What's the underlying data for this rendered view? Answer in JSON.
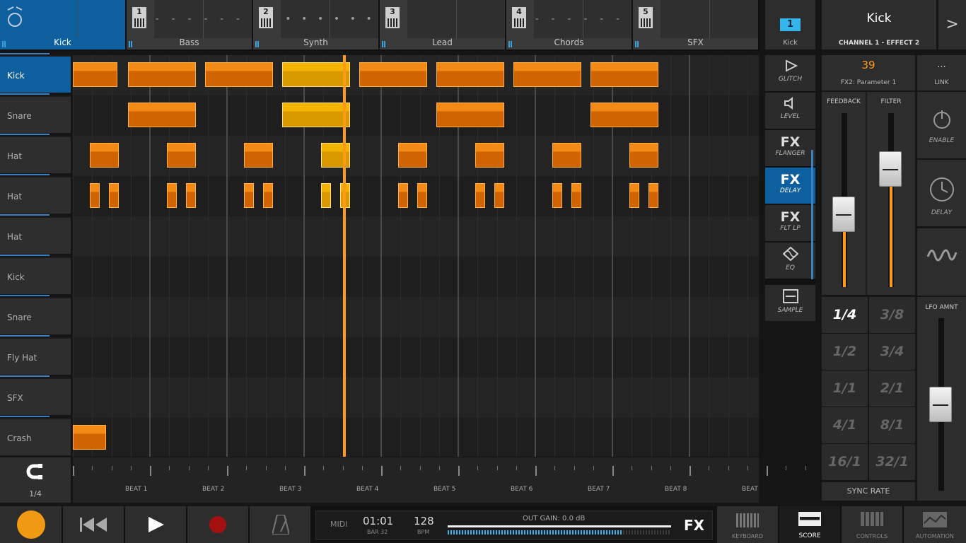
{
  "tracks": [
    {
      "label": "Kick",
      "pattern": ""
    },
    {
      "label": "Bass",
      "num": "1",
      "pattern": "- - - -  - - - -"
    },
    {
      "label": "Synth",
      "num": "2",
      "pattern": "• • •   • • •"
    },
    {
      "label": "Lead",
      "num": "3",
      "pattern": "_ _ _ _ _ _ _ _"
    },
    {
      "label": "Chords",
      "num": "4",
      "pattern": "- - - - - - - - -"
    },
    {
      "label": "SFX",
      "num": "5",
      "pattern": "___________"
    }
  ],
  "channel": {
    "number": "1",
    "label": "Kick"
  },
  "header": {
    "title": "Kick",
    "subtitle": "CHANNEL 1 - EFFECT 2",
    "next": ">"
  },
  "rows": [
    "Kick",
    "Snare",
    "Hat",
    "Hat",
    "Hat",
    "Kick",
    "Snare",
    "Fly Hat",
    "SFX",
    "Crash"
  ],
  "notes": [
    {
      "row": 0,
      "cols": [
        [
          0,
          0.6
        ],
        [
          0.7,
          1.6
        ],
        [
          1.7,
          2.6
        ],
        [
          2.7,
          3.6
        ],
        [
          3.7,
          4.6
        ],
        [
          4.7,
          5.6
        ],
        [
          5.7,
          6.6
        ],
        [
          6.7,
          7.6
        ]
      ],
      "sel": [
        3
      ]
    },
    {
      "row": 1,
      "cols": [
        [
          0.7,
          1.6
        ],
        [
          2.7,
          3.6
        ],
        [
          4.7,
          5.6
        ],
        [
          6.7,
          7.6
        ]
      ],
      "sel": [
        1
      ]
    },
    {
      "row": 2,
      "cols": [
        [
          0.2,
          0.6
        ],
        [
          1.2,
          1.6
        ],
        [
          2.2,
          2.6
        ],
        [
          3.2,
          3.6
        ],
        [
          4.2,
          4.6
        ],
        [
          5.2,
          5.6
        ],
        [
          6.2,
          6.6
        ],
        [
          7.2,
          7.6
        ]
      ],
      "sel": [
        3
      ]
    },
    {
      "row": 3,
      "cols": [
        [
          0.2,
          0.35
        ],
        [
          0.45,
          0.6
        ],
        [
          1.2,
          1.35
        ],
        [
          1.45,
          1.6
        ],
        [
          2.2,
          2.35
        ],
        [
          2.45,
          2.6
        ],
        [
          3.2,
          3.35
        ],
        [
          3.45,
          3.6
        ],
        [
          4.2,
          4.35
        ],
        [
          4.45,
          4.6
        ],
        [
          5.2,
          5.35
        ],
        [
          5.45,
          5.6
        ],
        [
          6.2,
          6.35
        ],
        [
          6.45,
          6.6
        ],
        [
          7.2,
          7.35
        ],
        [
          7.45,
          7.6
        ]
      ],
      "sel": [
        6,
        7
      ]
    },
    {
      "row": 9,
      "cols": [
        [
          0,
          0.45
        ]
      ],
      "sel": []
    }
  ],
  "snap": {
    "value": "1/4",
    "icon": "magnet-icon"
  },
  "beats": [
    "BEAT 1",
    "BEAT 2",
    "BEAT 3",
    "BEAT 4",
    "BEAT 5",
    "BEAT 6",
    "BEAT 7",
    "BEAT 8",
    "BEAT"
  ],
  "fx": [
    {
      "big": "",
      "sm": "GLITCH",
      "icon": "glitch-icon"
    },
    {
      "big": "",
      "sm": "LEVEL",
      "icon": "speaker-icon"
    },
    {
      "big": "FX",
      "sm": "FLANGER"
    },
    {
      "big": "FX",
      "sm": "DELAY",
      "active": true
    },
    {
      "big": "FX",
      "sm": "FLT LP"
    },
    {
      "big": "",
      "sm": "EQ",
      "icon": "eq-icon"
    },
    {
      "big": "",
      "sm": "SAMPLE",
      "icon": "sample-icon"
    }
  ],
  "param": {
    "value": "39",
    "label": "FX2: Parameter 1"
  },
  "link": {
    "dots": "...",
    "label": "LINK"
  },
  "sliders": [
    {
      "label": "FEEDBACK",
      "level": 0.42
    },
    {
      "label": "FILTER",
      "level": 0.68
    }
  ],
  "side": [
    {
      "label": "ENABLE",
      "icon": "power-icon"
    },
    {
      "label": "DELAY",
      "icon": "clock-icon"
    },
    {
      "label": "",
      "icon": "lfo-wave-icon"
    }
  ],
  "rates": [
    "1/4",
    "3/8",
    "1/2",
    "3/4",
    "1/1",
    "2/1",
    "4/1",
    "8/1",
    "16/1",
    "32/1"
  ],
  "sync_label": "SYNC RATE",
  "lfo": {
    "label": "LFO AMNT",
    "level": 0.5
  },
  "transport": {
    "midi": "MIDI",
    "time": "01:01",
    "bar": "BAR 32",
    "bpm": "128",
    "bpm_label": "BPM",
    "gain": "OUT GAIN: 0.0 dB",
    "fx": "FX",
    "meter_level": 0.78
  },
  "bottom": [
    {
      "label": "KEYBOARD"
    },
    {
      "label": "SCORE",
      "active": true
    },
    {
      "label": "CONTROLS"
    },
    {
      "label": "AUTOMATION"
    }
  ],
  "colors": {
    "accent": "#ff9a18",
    "active": "#0e5f9e",
    "badge": "#34b6ec"
  }
}
